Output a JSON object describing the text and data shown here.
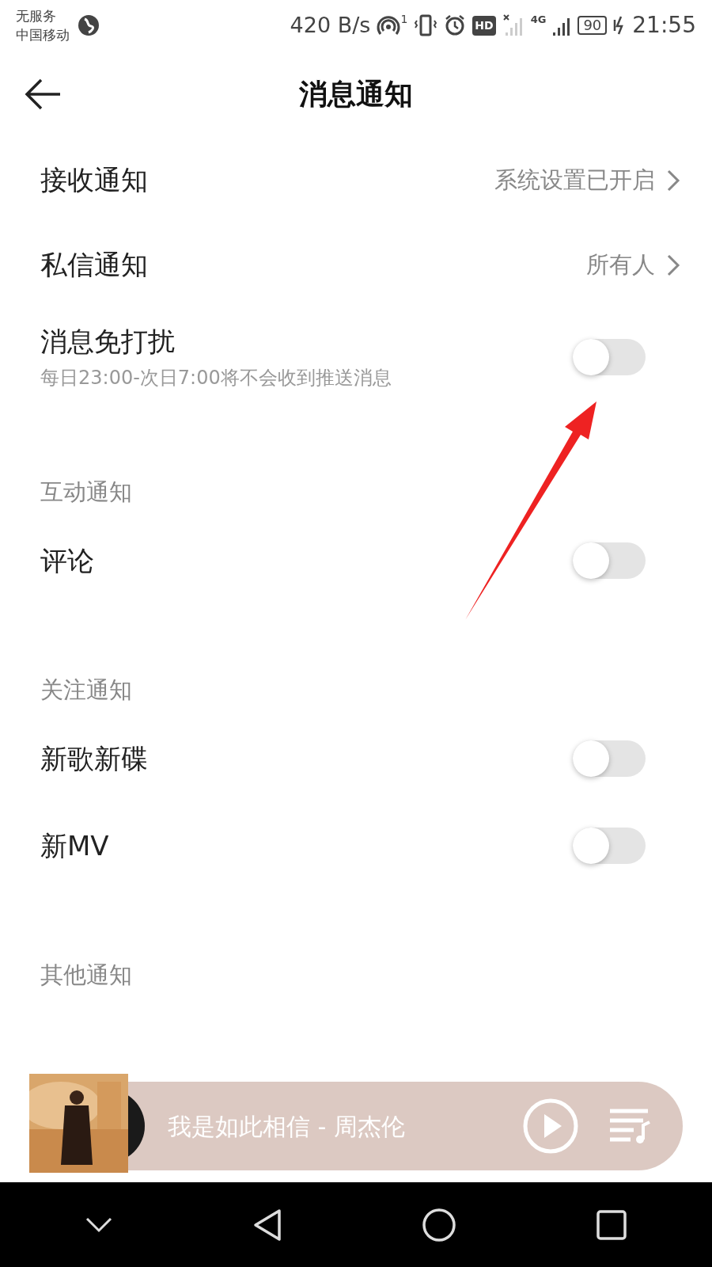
{
  "status_bar": {
    "carrier_lines": [
      "无服务",
      "中国移动"
    ],
    "speed": "420 B/s",
    "hotspot_count": "1",
    "hd": "HD",
    "network": "4G",
    "battery": "90",
    "time": "21:55"
  },
  "header": {
    "title": "消息通知"
  },
  "rows": [
    {
      "kind": "link",
      "label": "接收通知",
      "value": "系统设置已开启"
    },
    {
      "kind": "link",
      "label": "私信通知",
      "value": "所有人"
    },
    {
      "kind": "toggle",
      "label": "消息免打扰",
      "subtitle": "每日23:00-次日7:00将不会收到推送消息",
      "on": false
    },
    {
      "kind": "heading",
      "label": "互动通知"
    },
    {
      "kind": "toggle",
      "label": "评论",
      "on": false
    },
    {
      "kind": "heading",
      "label": "关注通知"
    },
    {
      "kind": "toggle",
      "label": "新歌新碟",
      "on": false
    },
    {
      "kind": "toggle",
      "label": "新MV",
      "on": false
    },
    {
      "kind": "heading",
      "label": "其他通知"
    }
  ],
  "player": {
    "song": "我是如此相信 - 周杰伦"
  }
}
